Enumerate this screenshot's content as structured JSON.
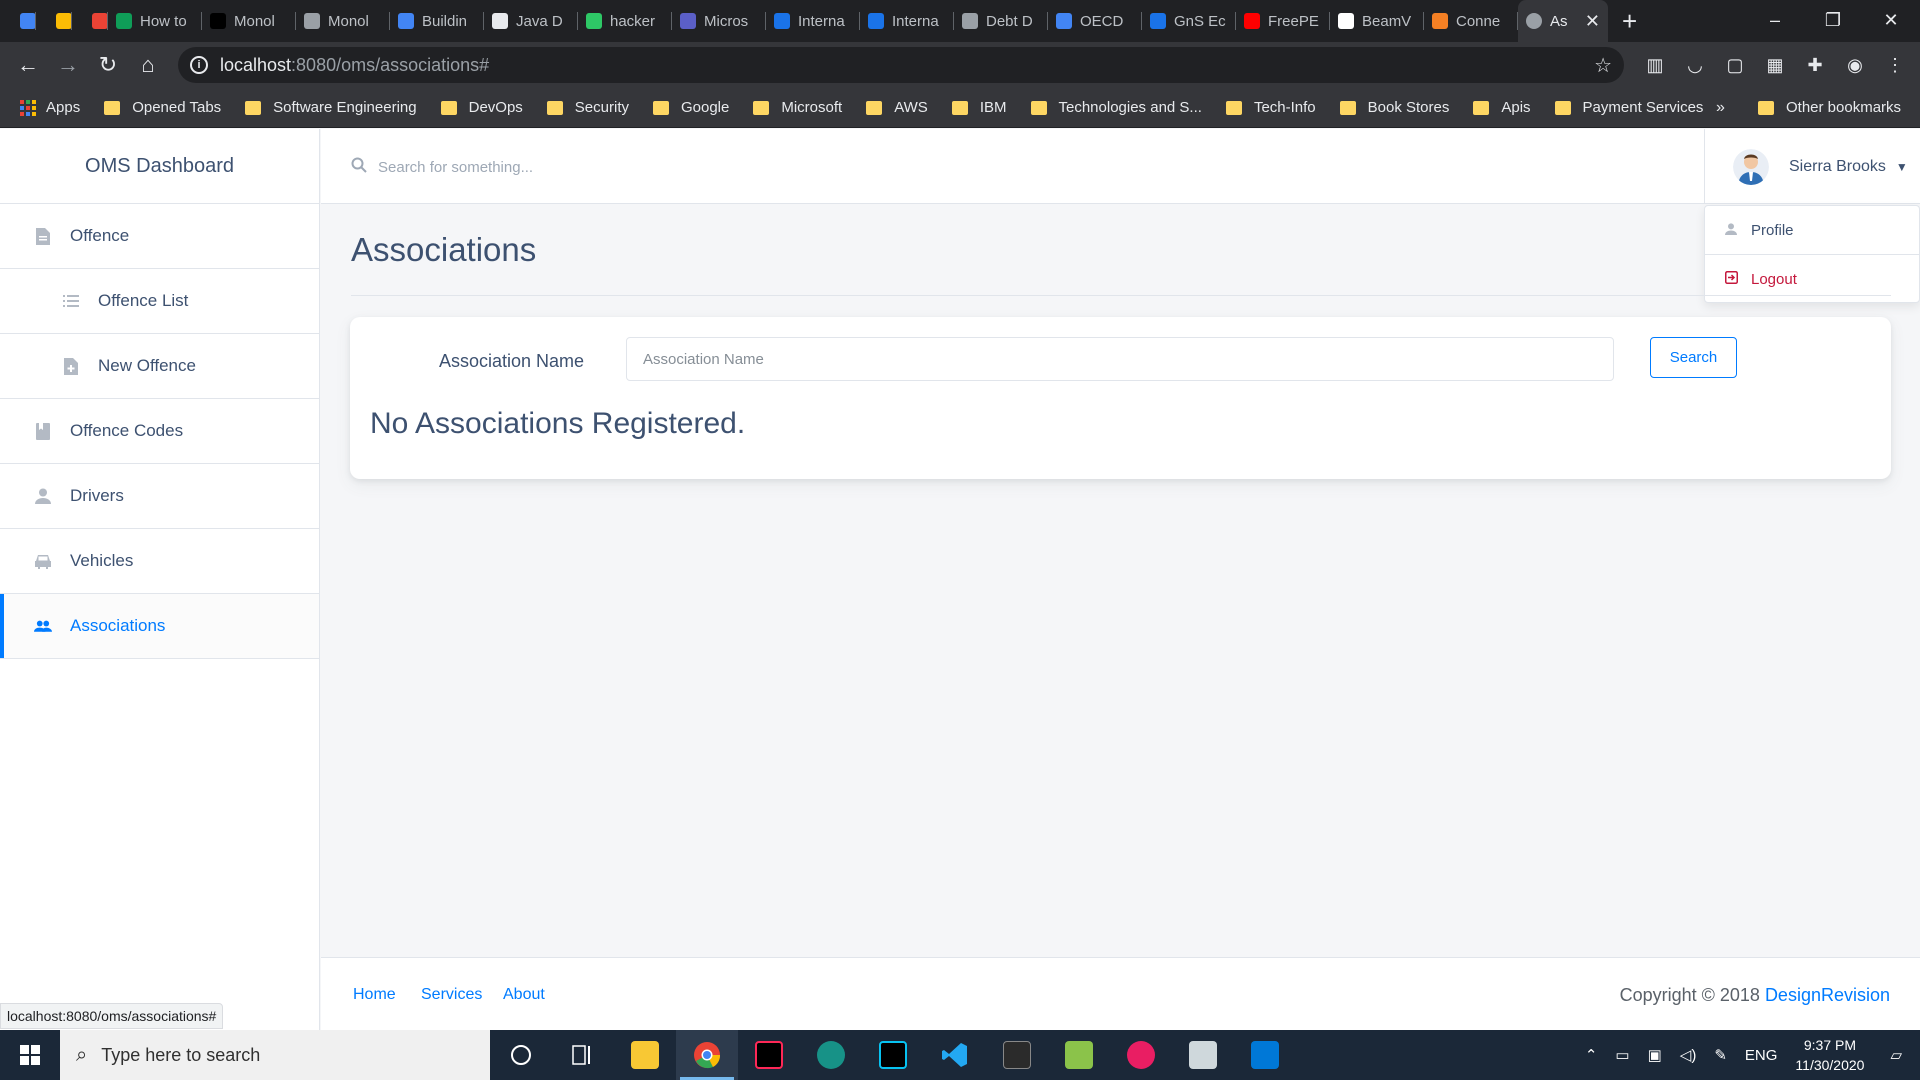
{
  "browser": {
    "tabs": [
      {
        "label": "",
        "color": "#4285f4"
      },
      {
        "label": "",
        "color": "#fbbc05"
      },
      {
        "label": "",
        "color": "#ea4335"
      },
      {
        "label": "How to",
        "color": "#0f9d58"
      },
      {
        "label": "Monol",
        "color": "#000000"
      },
      {
        "label": "Monol",
        "color": "#9aa0a6"
      },
      {
        "label": "Buildin",
        "color": "#4285f4"
      },
      {
        "label": "Java D",
        "color": "#e8eaed"
      },
      {
        "label": "hacker",
        "color": "#2ec866"
      },
      {
        "label": "Micros",
        "color": "#5b5fc7"
      },
      {
        "label": "Interna",
        "color": "#1a73e8"
      },
      {
        "label": "Interna",
        "color": "#1a73e8"
      },
      {
        "label": "Debt D",
        "color": "#9aa0a6"
      },
      {
        "label": "OECD",
        "color": "#4285f4"
      },
      {
        "label": "GnS Ec",
        "color": "#1a73e8"
      },
      {
        "label": "FreePE",
        "color": "#ff0000"
      },
      {
        "label": "BeamV",
        "color": "#ffffff"
      },
      {
        "label": "Conne",
        "color": "#f48024"
      }
    ],
    "active_tab": {
      "label": "As"
    },
    "new_tab": "+",
    "window_controls": [
      "–",
      "❐",
      "✕"
    ],
    "url_host": "localhost",
    "url_path": ":8080/oms/associations#",
    "bookmarks": [
      "Apps",
      "Opened Tabs",
      "Software Engineering",
      "DevOps",
      "Security",
      "Google",
      "Microsoft",
      "AWS",
      "IBM",
      "Technologies and S...",
      "Tech-Info",
      "Book Stores",
      "Apis",
      "Payment Services"
    ],
    "bookmarks_more": "»",
    "other_bookmarks": "Other bookmarks",
    "status_url": "localhost:8080/oms/associations#"
  },
  "sidebar": {
    "brand": "OMS Dashboard",
    "items": [
      {
        "label": "Offence",
        "icon": "document-icon"
      },
      {
        "label": "Offence List",
        "icon": "list-icon"
      },
      {
        "label": "New Offence",
        "icon": "add-document-icon"
      },
      {
        "label": "Offence Codes",
        "icon": "bookmark-icon"
      },
      {
        "label": "Drivers",
        "icon": "person-icon"
      },
      {
        "label": "Vehicles",
        "icon": "car-icon"
      },
      {
        "label": "Associations",
        "icon": "people-icon"
      }
    ]
  },
  "header": {
    "search_placeholder": "Search for something...",
    "user_name": "Sierra Brooks",
    "menu": {
      "profile": "Profile",
      "logout": "Logout"
    }
  },
  "main": {
    "title": "Associations",
    "form": {
      "label": "Association Name",
      "placeholder": "Association Name",
      "button": "Search"
    },
    "empty_message": "No Associations Registered."
  },
  "footer": {
    "links": [
      "Home",
      "Services",
      "About"
    ],
    "copyright": "Copyright © 2018 ",
    "brand": "DesignRevision"
  },
  "taskbar": {
    "search_placeholder": "Type here to search",
    "language": "ENG",
    "time": "9:37 PM",
    "date": "11/30/2020"
  },
  "colors": {
    "accent": "#007bff",
    "text": "#3d5170",
    "danger": "#c4183c"
  }
}
